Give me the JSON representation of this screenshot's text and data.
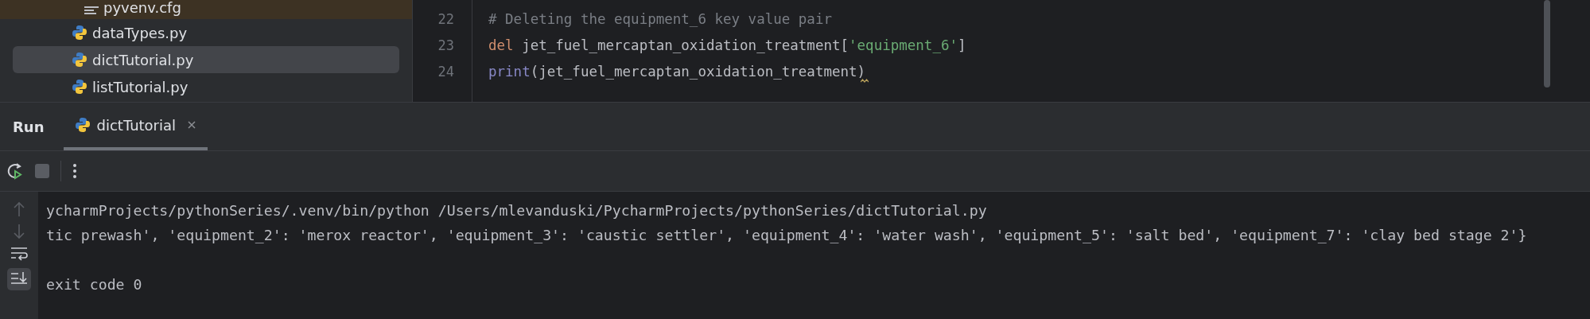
{
  "project_tree": [
    {
      "name": "pyvenv.cfg",
      "kind": "config",
      "selected": false,
      "highlighted": true
    },
    {
      "name": "dataTypes.py",
      "kind": "python",
      "selected": false,
      "highlighted": false
    },
    {
      "name": "dictTutorial.py",
      "kind": "python",
      "selected": true,
      "highlighted": false
    },
    {
      "name": "listTutorial.py",
      "kind": "python",
      "selected": false,
      "highlighted": false
    }
  ],
  "editor": {
    "lines": [
      {
        "number": "22",
        "tokens": [
          {
            "kind": "comment",
            "text": "# Deleting the equipment_6 key value pair"
          }
        ]
      },
      {
        "number": "23",
        "tokens": [
          {
            "kind": "keyword",
            "text": "del"
          },
          {
            "kind": "plain",
            "text": " jet_fuel_mercaptan_oxidation_treatment["
          },
          {
            "kind": "string",
            "text": "'equipment_6'"
          },
          {
            "kind": "plain",
            "text": "]"
          }
        ]
      },
      {
        "number": "24",
        "tokens": [
          {
            "kind": "builtin",
            "text": "print"
          },
          {
            "kind": "plain",
            "text": "(jet_fuel_mercaptan_oxidation_treatment)"
          }
        ],
        "warning": true
      }
    ]
  },
  "run_panel": {
    "title": "Run",
    "tabs": [
      {
        "label": "dictTutorial",
        "selected": true
      }
    ]
  },
  "console": {
    "lines": [
      "ycharmProjects/pythonSeries/.venv/bin/python /Users/mlevanduski/PycharmProjects/pythonSeries/dictTutorial.py",
      "tic prewash', 'equipment_2': 'merox reactor', 'equipment_3': 'caustic settler', 'equipment_4': 'water wash', 'equipment_5': 'salt bed', 'equipment_7': 'clay bed stage 2'}"
    ],
    "exit_message": "exit code 0"
  }
}
